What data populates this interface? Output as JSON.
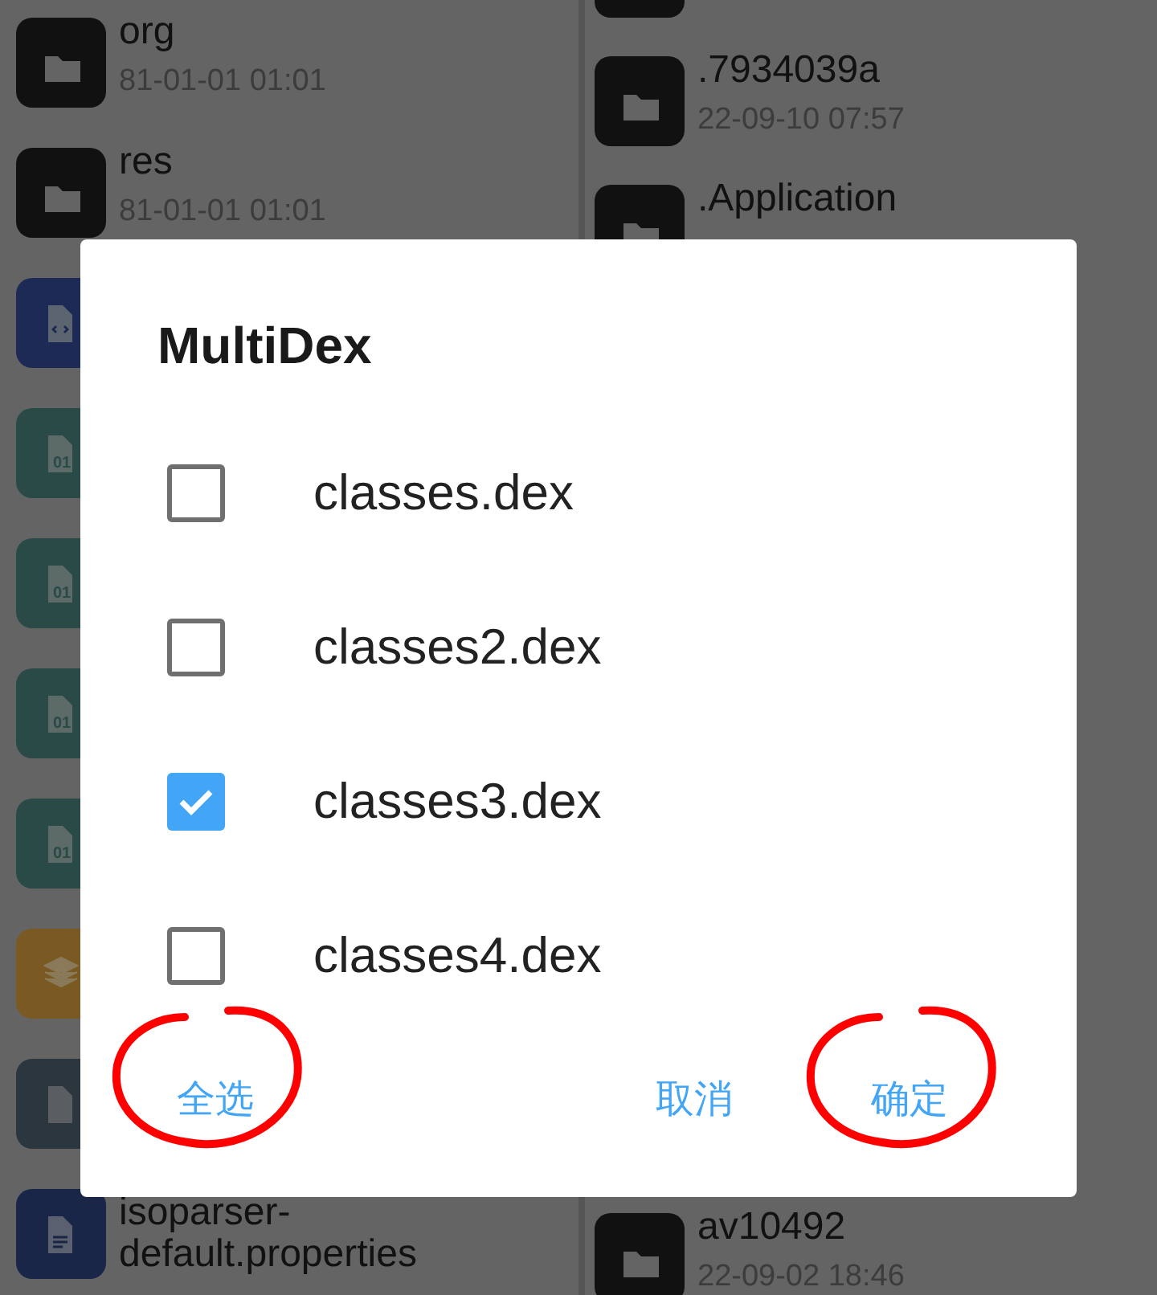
{
  "background": {
    "left_pane": [
      {
        "kind": "folder",
        "name": "org",
        "meta": "81-01-01 01:01"
      },
      {
        "kind": "folder",
        "name": "res",
        "meta": "81-01-01 01:01"
      },
      {
        "kind": "xml"
      },
      {
        "kind": "binary",
        "glyph": "01"
      },
      {
        "kind": "binary",
        "glyph": "01"
      },
      {
        "kind": "binary",
        "glyph": "01"
      },
      {
        "kind": "binary",
        "glyph": "01"
      },
      {
        "kind": "layers"
      },
      {
        "kind": "file"
      },
      {
        "kind": "doc",
        "name": "isoparser-\ndefault.properties"
      }
    ],
    "right_pane": [
      {
        "kind": "folder"
      },
      {
        "kind": "folder",
        "name": ".7934039a",
        "meta": "22-09-10 07:57"
      },
      {
        "kind": "folder",
        "name": ".Application"
      },
      {
        "kind": "none"
      },
      {
        "kind": "none"
      },
      {
        "kind": "none"
      },
      {
        "kind": "none"
      },
      {
        "kind": "none"
      },
      {
        "kind": "none"
      },
      {
        "kind": "none"
      },
      {
        "kind": "folder",
        "name": "av10492",
        "meta": "22-09-02 18:46"
      }
    ]
  },
  "dialog": {
    "title": "MultiDex",
    "items": [
      {
        "label": "classes.dex",
        "checked": false
      },
      {
        "label": "classes2.dex",
        "checked": false
      },
      {
        "label": "classes3.dex",
        "checked": true
      },
      {
        "label": "classes4.dex",
        "checked": false
      }
    ],
    "buttons": [
      {
        "label": "全选",
        "kind": "neutral",
        "circled": true
      },
      {
        "label": "取消",
        "kind": "negative",
        "circled": false
      },
      {
        "label": "确定",
        "kind": "positive",
        "circled": true
      }
    ]
  }
}
